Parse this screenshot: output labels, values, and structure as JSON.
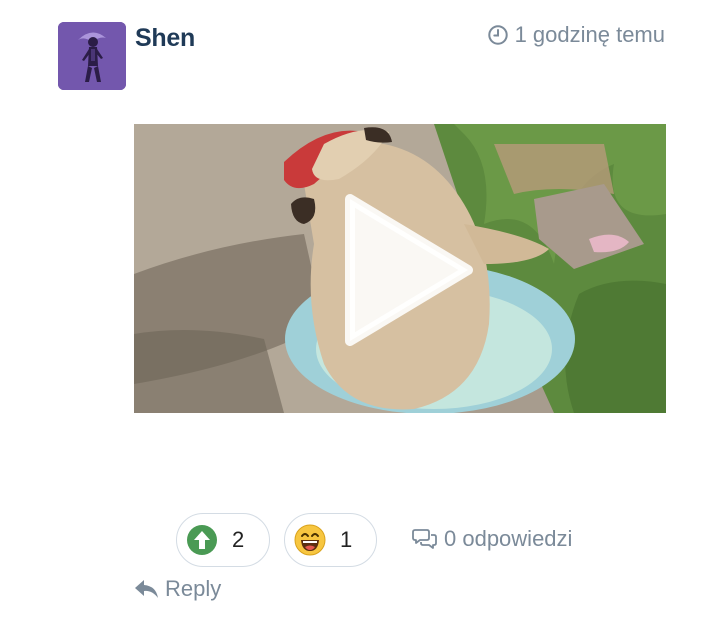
{
  "post": {
    "author": "Shen",
    "timestamp": "1 godzinę temu"
  },
  "icons": {
    "avatar": "user-avatar",
    "clock": "clock-icon",
    "play": "play-icon",
    "upvote": "arrow-up-circle-icon",
    "laugh": "laughing-emoji-icon",
    "replies": "speech-bubbles-icon",
    "reply": "reply-arrow-icon"
  },
  "reactions": {
    "upvote_count": "2",
    "laugh_count": "1"
  },
  "footer": {
    "replies_label": "0 odpowiedzi",
    "reply_label": "Reply"
  },
  "colors": {
    "author": "#1f3a57",
    "muted": "#7b8a99",
    "upvote_green": "#4a9a54",
    "avatar_bg": "#6b4fa3"
  }
}
